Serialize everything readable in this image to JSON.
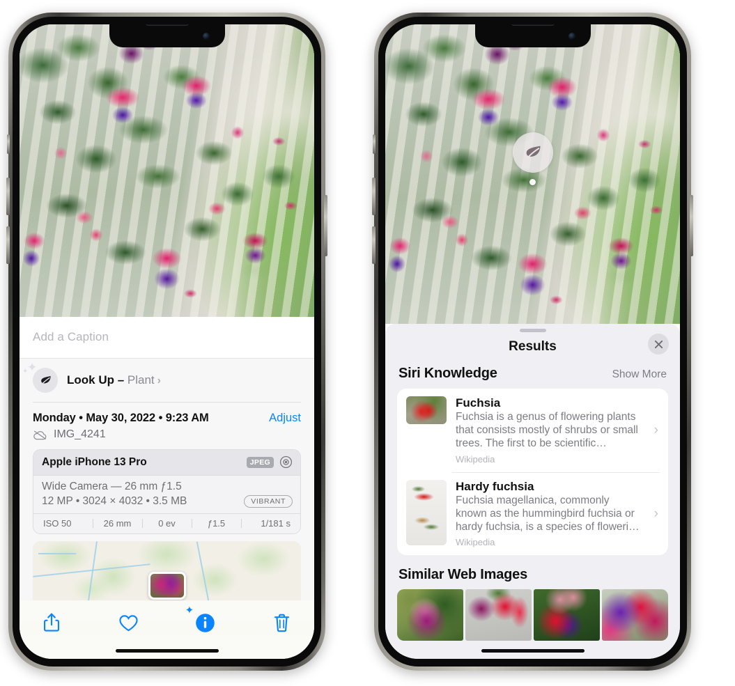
{
  "left_phone": {
    "caption_placeholder": "Add a Caption",
    "lookup": {
      "label": "Look Up – ",
      "subject": "Plant",
      "chevron": "›",
      "icon": "leaf-icon"
    },
    "date": "Monday • May 30, 2022 • 9:23 AM",
    "adjust_label": "Adjust",
    "filename": "IMG_4241",
    "exif": {
      "device": "Apple iPhone 13 Pro",
      "format_badge": "JPEG",
      "lens_line": "Wide Camera — 26 mm ƒ1.5",
      "spec_line": "12 MP • 3024 × 4032 • 3.5 MB",
      "vibrant_badge": "VIBRANT",
      "stats": [
        "ISO 50",
        "26 mm",
        "0 ev",
        "ƒ1.5",
        "1/181 s"
      ]
    },
    "toolbar": {
      "share_label": "share-icon",
      "favorite_label": "heart-icon",
      "info_label": "info-icon",
      "delete_label": "trash-icon"
    }
  },
  "right_phone": {
    "marker_icon": "leaf-icon",
    "sheet_title": "Results",
    "close_label": "✕",
    "siri_section": {
      "title": "Siri Knowledge",
      "action": "Show More",
      "cards": [
        {
          "title": "Fuchsia",
          "description": "Fuchsia is a genus of flowering plants that consists mostly of shrubs or small trees. The first to be scientific…",
          "source": "Wikipedia",
          "chevron": "›"
        },
        {
          "title": "Hardy fuchsia",
          "description": "Fuchsia magellanica, commonly known as the hummingbird fuchsia or hardy fuchsia, is a species of floweri…",
          "source": "Wikipedia",
          "chevron": "›"
        }
      ]
    },
    "web_section": {
      "title": "Similar Web Images",
      "thumbs": [
        "web-image-1",
        "web-image-2",
        "web-image-3",
        "web-image-4"
      ]
    }
  },
  "colors": {
    "accent_blue": "#0a84ff",
    "sheet_bg": "#f0f0f4",
    "info_bg": "#f7f7f8",
    "muted_text": "#7c7c84"
  }
}
